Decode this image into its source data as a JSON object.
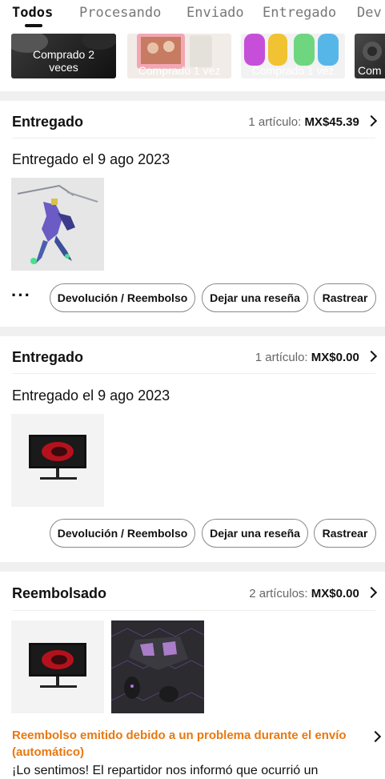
{
  "tabs": [
    "Todos",
    "Procesando",
    "Enviado",
    "Entregado",
    "Dev"
  ],
  "thumbs": [
    "Comprado 2\nveces",
    "Comprado 1 vez",
    "Comprado 1 vez",
    "Com"
  ],
  "orders": [
    {
      "status": "Entregado",
      "count_label": "1 artículo:",
      "price": "MX$45.39",
      "delivered": "Entregado el 9 ago 2023",
      "more": "···",
      "buttons": [
        "Devolución / Reembolso",
        "Dejar una reseña",
        "Rastrear"
      ]
    },
    {
      "status": "Entregado",
      "count_label": "1 artículo:",
      "price": "MX$0.00",
      "delivered": "Entregado el 9 ago 2023",
      "buttons": [
        "Devolución / Reembolso",
        "Dejar una reseña",
        "Rastrear"
      ]
    },
    {
      "status": "Reembolsado",
      "count_label": "2 artículos:",
      "price": "MX$0.00",
      "refund_title": "Reembolso emitido debido a un problema durante el envío (automático)",
      "refund_body": "¡Lo sentimos! El repartidor nos informó que ocurrió un"
    }
  ]
}
